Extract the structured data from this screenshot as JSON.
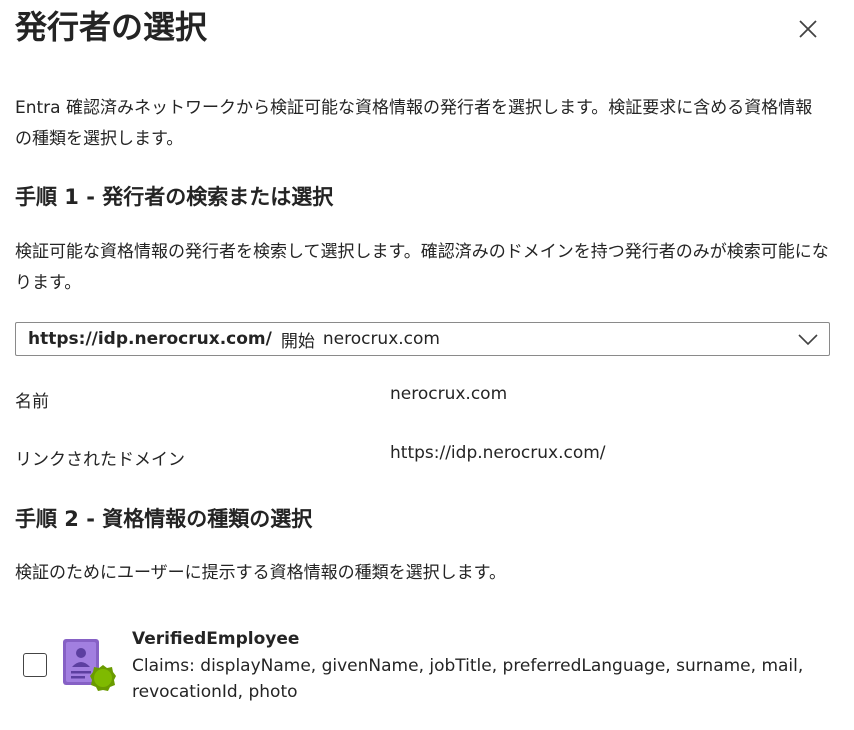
{
  "panel": {
    "title": "発行者の選択",
    "intro": "Entra 確認済みネットワークから検証可能な資格情報の発行者を選択します。検証要求に含める資格情報の種類を選択します。"
  },
  "step1": {
    "heading": "手順 1 - 発行者の検索または選択",
    "description": "検証可能な資格情報の発行者を検索して選択します。確認済みのドメインを持つ発行者のみが検索可能になります。",
    "dropdown": {
      "url": "https://idp.nerocrux.com/",
      "from_label": "開始",
      "domain": "nerocrux.com"
    },
    "fields": {
      "name_label": "名前",
      "name_value": "nerocrux.com",
      "linked_domain_label": "リンクされたドメイン",
      "linked_domain_value": "https://idp.nerocrux.com/"
    }
  },
  "step2": {
    "heading": "手順 2 - 資格情報の種類の選択",
    "description": "検証のためにユーザーに提示する資格情報の種類を選択します。",
    "credentials": [
      {
        "name": "VerifiedEmployee",
        "claims": "Claims: displayName, givenName, jobTitle, preferredLanguage, surname, mail, revocationId, photo",
        "checked": false,
        "icon": "credential-card-icon"
      }
    ]
  },
  "colors": {
    "text": "#242424",
    "icon_purple": "#8661c5",
    "badge_green": "#7fba00"
  }
}
